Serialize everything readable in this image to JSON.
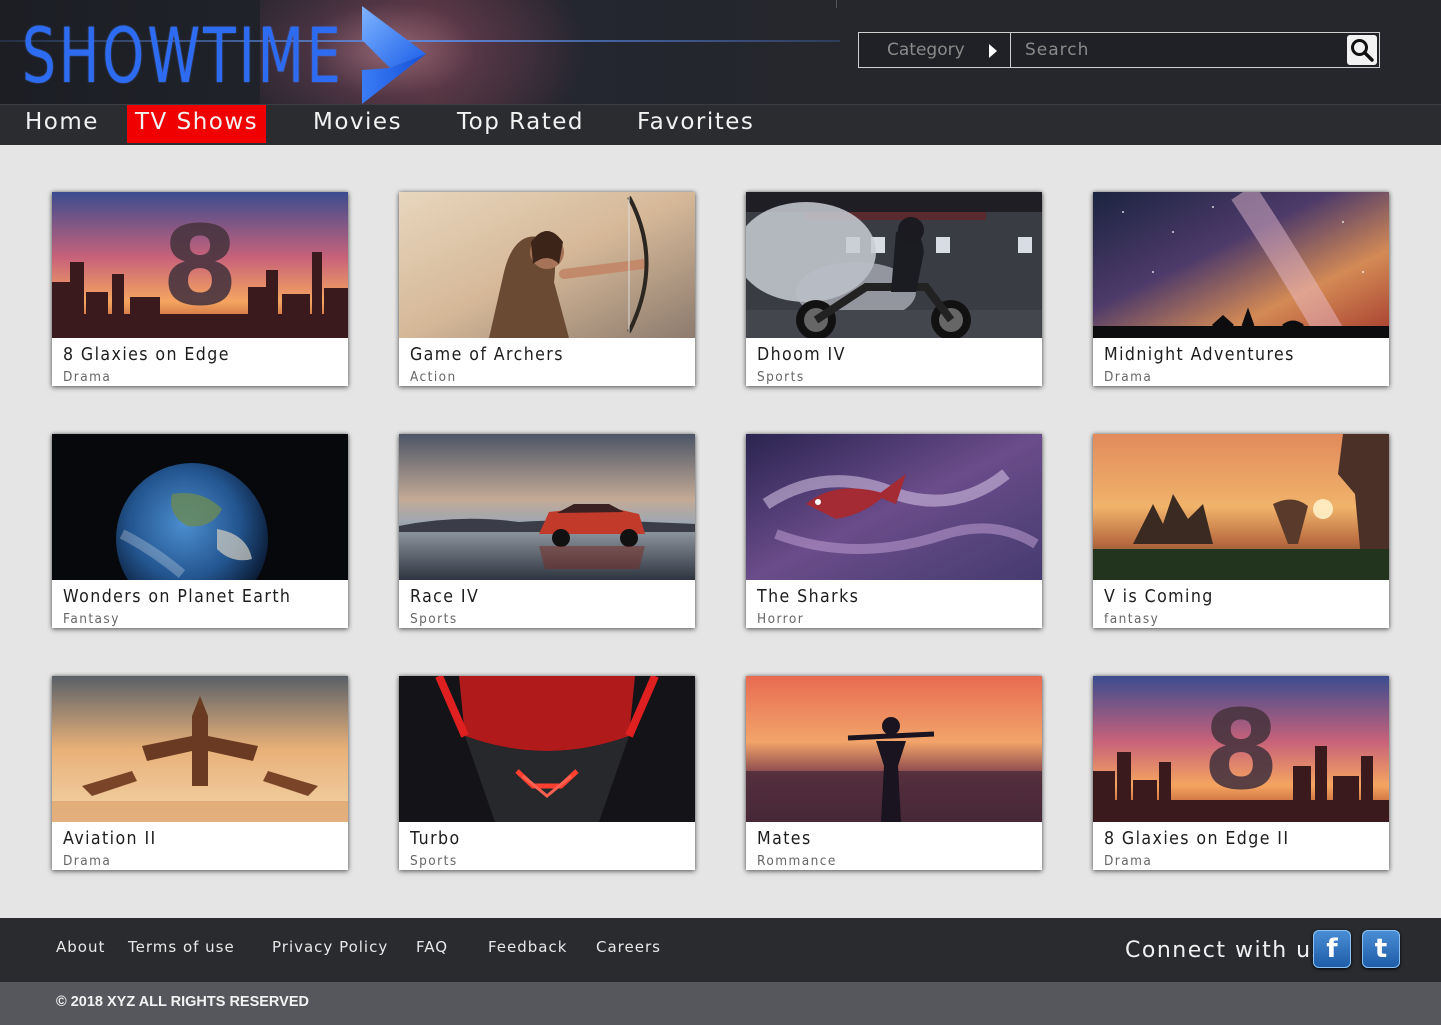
{
  "brand": {
    "name": "SHOWTIME",
    "accent": "#2d6bf0"
  },
  "search": {
    "category_label": "Category",
    "placeholder": "Search",
    "icon": "search-icon"
  },
  "nav": {
    "items": [
      {
        "label": "Home",
        "active": false
      },
      {
        "label": "TV Shows",
        "active": true
      },
      {
        "label": "Movies",
        "active": false
      },
      {
        "label": "Top Rated",
        "active": false
      },
      {
        "label": "Favorites",
        "active": false
      }
    ],
    "active_color": "#f00000"
  },
  "cards": [
    {
      "title": "8 Glaxies on Edge",
      "genre": "Drama"
    },
    {
      "title": "Game of Archers",
      "genre": "Action"
    },
    {
      "title": "Dhoom IV",
      "genre": "Sports"
    },
    {
      "title": "Midnight Adventures",
      "genre": "Drama"
    },
    {
      "title": "Wonders on Planet Earth",
      "genre": "Fantasy"
    },
    {
      "title": "Race IV",
      "genre": "Sports"
    },
    {
      "title": "The Sharks",
      "genre": "Horror"
    },
    {
      "title": "V is Coming",
      "genre": "fantasy"
    },
    {
      "title": "Aviation II",
      "genre": "Drama"
    },
    {
      "title": "Turbo",
      "genre": "Sports"
    },
    {
      "title": "Mates",
      "genre": "Rommance"
    },
    {
      "title": "8 Glaxies on Edge II",
      "genre": "Drama"
    }
  ],
  "footer": {
    "links": [
      "About",
      "Terms of use",
      "Privacy Policy",
      "FAQ",
      "Feedback",
      "Careers"
    ],
    "connect_label": "Connect with us",
    "social": [
      {
        "name": "facebook-icon",
        "glyph": "f"
      },
      {
        "name": "tumblr-icon",
        "glyph": "t"
      }
    ],
    "copyright": "© 2018 XYZ ALL RIGHTS RESERVED"
  }
}
